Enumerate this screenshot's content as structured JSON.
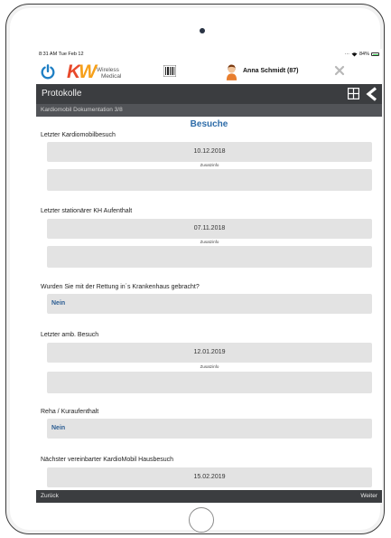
{
  "colors": {
    "accent": "#2e6ca8",
    "title_bar": "#3b3d40",
    "subtitle_bar": "#525458",
    "field_background": "#e3e3e3",
    "brand_red": "#e8492b",
    "brand_orange": "#f6a01a",
    "power_icon": "#1e7fc4"
  },
  "status_bar": {
    "time_date": "8:31 AM  Tue Feb 12",
    "battery": "84%"
  },
  "app_header": {
    "logo_letters": "KW",
    "logo_text_line1": "Wireless",
    "logo_text_line2": "Medical",
    "patient_name": "Anna Schmidt (87)",
    "icons": [
      "power-icon",
      "barcode-icon",
      "avatar",
      "close-icon"
    ]
  },
  "title_bar": {
    "title": "Protokolle",
    "icons": [
      "grid-icon",
      "back-chevron-icon"
    ]
  },
  "subtitle": "Kardiomobil Dokumentation 3/8",
  "section": {
    "heading": "Besuche",
    "fields": [
      {
        "label": "Letzter Kardiomobilbesuch",
        "value": "10.12.2018",
        "extra_label": "Zusatzinfo",
        "extra_value": ""
      },
      {
        "label": "Letzter stationärer KH Aufenthalt",
        "value": "07.11.2018",
        "extra_label": "Zusatzinfo",
        "extra_value": ""
      },
      {
        "label": "Wurden Sie mit der Rettung in´s Krankenhaus gebracht?",
        "value": "Nein"
      },
      {
        "label": "Letzter amb. Besuch",
        "value": "12.01.2019",
        "extra_label": "Zusatzinfo",
        "extra_value": ""
      },
      {
        "label": "Reha / Kuraufenthalt",
        "value": "Nein"
      },
      {
        "label": "Nächster vereinbarter KardioMobil Hausbesuch",
        "value": "15.02.2019"
      }
    ]
  },
  "bottom_bar": {
    "back_label": "Zurück",
    "next_label": "Weiter"
  }
}
